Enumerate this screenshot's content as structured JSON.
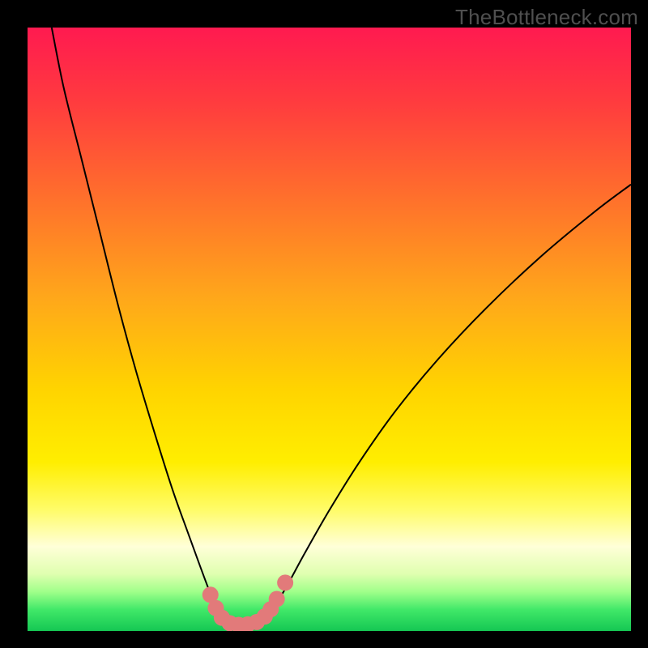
{
  "watermark": "TheBottleneck.com",
  "chart_data": {
    "type": "line",
    "title": "",
    "xlabel": "",
    "ylabel": "",
    "x_range": [
      0,
      100
    ],
    "y_range": [
      0,
      100
    ],
    "axes_visible": false,
    "grid": false,
    "background_gradient": {
      "stops": [
        {
          "offset": 0.0,
          "color": "#ff1a50"
        },
        {
          "offset": 0.12,
          "color": "#ff3a3f"
        },
        {
          "offset": 0.28,
          "color": "#ff6f2c"
        },
        {
          "offset": 0.45,
          "color": "#ffa81a"
        },
        {
          "offset": 0.6,
          "color": "#ffd400"
        },
        {
          "offset": 0.72,
          "color": "#ffee00"
        },
        {
          "offset": 0.8,
          "color": "#fffc6a"
        },
        {
          "offset": 0.86,
          "color": "#ffffd8"
        },
        {
          "offset": 0.905,
          "color": "#e0ffb0"
        },
        {
          "offset": 0.935,
          "color": "#a0ff8a"
        },
        {
          "offset": 0.965,
          "color": "#40e868"
        },
        {
          "offset": 1.0,
          "color": "#15c753"
        }
      ]
    },
    "series": [
      {
        "name": "bottleneck-curve",
        "color": "#000000",
        "width": 2.0,
        "points": [
          {
            "x": 4.0,
            "y": 100.0
          },
          {
            "x": 6.0,
            "y": 90.0
          },
          {
            "x": 9.0,
            "y": 78.0
          },
          {
            "x": 12.0,
            "y": 66.0
          },
          {
            "x": 15.0,
            "y": 54.0
          },
          {
            "x": 18.0,
            "y": 43.0
          },
          {
            "x": 21.0,
            "y": 33.0
          },
          {
            "x": 24.0,
            "y": 23.5
          },
          {
            "x": 26.5,
            "y": 16.5
          },
          {
            "x": 28.5,
            "y": 11.0
          },
          {
            "x": 30.0,
            "y": 7.0
          },
          {
            "x": 31.3,
            "y": 4.0
          },
          {
            "x": 32.5,
            "y": 2.2
          },
          {
            "x": 34.0,
            "y": 1.2
          },
          {
            "x": 36.0,
            "y": 1.0
          },
          {
            "x": 38.0,
            "y": 1.3
          },
          {
            "x": 39.5,
            "y": 2.3
          },
          {
            "x": 41.0,
            "y": 4.2
          },
          {
            "x": 43.0,
            "y": 7.5
          },
          {
            "x": 46.0,
            "y": 13.0
          },
          {
            "x": 50.0,
            "y": 20.0
          },
          {
            "x": 55.0,
            "y": 28.0
          },
          {
            "x": 61.0,
            "y": 36.5
          },
          {
            "x": 68.0,
            "y": 45.0
          },
          {
            "x": 76.0,
            "y": 53.5
          },
          {
            "x": 85.0,
            "y": 62.0
          },
          {
            "x": 94.0,
            "y": 69.5
          },
          {
            "x": 100.0,
            "y": 74.0
          }
        ]
      }
    ],
    "markers": {
      "name": "highlight-dots",
      "color": "#e27a7a",
      "radius": 10,
      "points": [
        {
          "x": 30.3,
          "y": 6.0
        },
        {
          "x": 31.2,
          "y": 3.8
        },
        {
          "x": 32.2,
          "y": 2.2
        },
        {
          "x": 33.5,
          "y": 1.3
        },
        {
          "x": 35.0,
          "y": 1.0
        },
        {
          "x": 36.5,
          "y": 1.1
        },
        {
          "x": 38.0,
          "y": 1.5
        },
        {
          "x": 39.3,
          "y": 2.4
        },
        {
          "x": 40.3,
          "y": 3.6
        },
        {
          "x": 41.3,
          "y": 5.3
        },
        {
          "x": 42.7,
          "y": 8.0
        }
      ]
    }
  }
}
